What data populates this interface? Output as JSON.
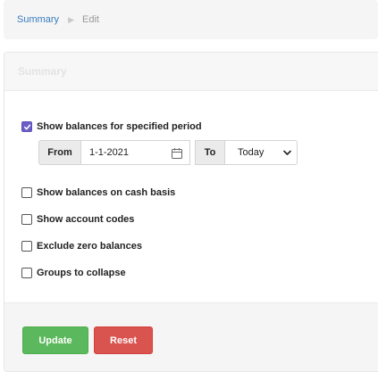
{
  "breadcrumb": {
    "items": [
      "Summary",
      "Edit"
    ]
  },
  "panel": {
    "title": "Summary"
  },
  "options": {
    "specified_period": {
      "label": "Show balances for specified period",
      "checked": true
    },
    "from_label": "From",
    "from_date": "1-1-2021",
    "to_label": "To",
    "to_value": "Today",
    "cash_basis": {
      "label": "Show balances on cash basis",
      "checked": false
    },
    "account_codes": {
      "label": "Show account codes",
      "checked": false
    },
    "exclude_zero": {
      "label": "Exclude zero balances",
      "checked": false
    },
    "groups_collapse": {
      "label": "Groups to collapse",
      "checked": false
    }
  },
  "actions": {
    "update_label": "Update",
    "reset_label": "Reset"
  },
  "colors": {
    "update": "#5cb85c",
    "reset": "#d9534f",
    "link": "#3a7cc0",
    "checkbox_accent": "#6b5fc7"
  }
}
